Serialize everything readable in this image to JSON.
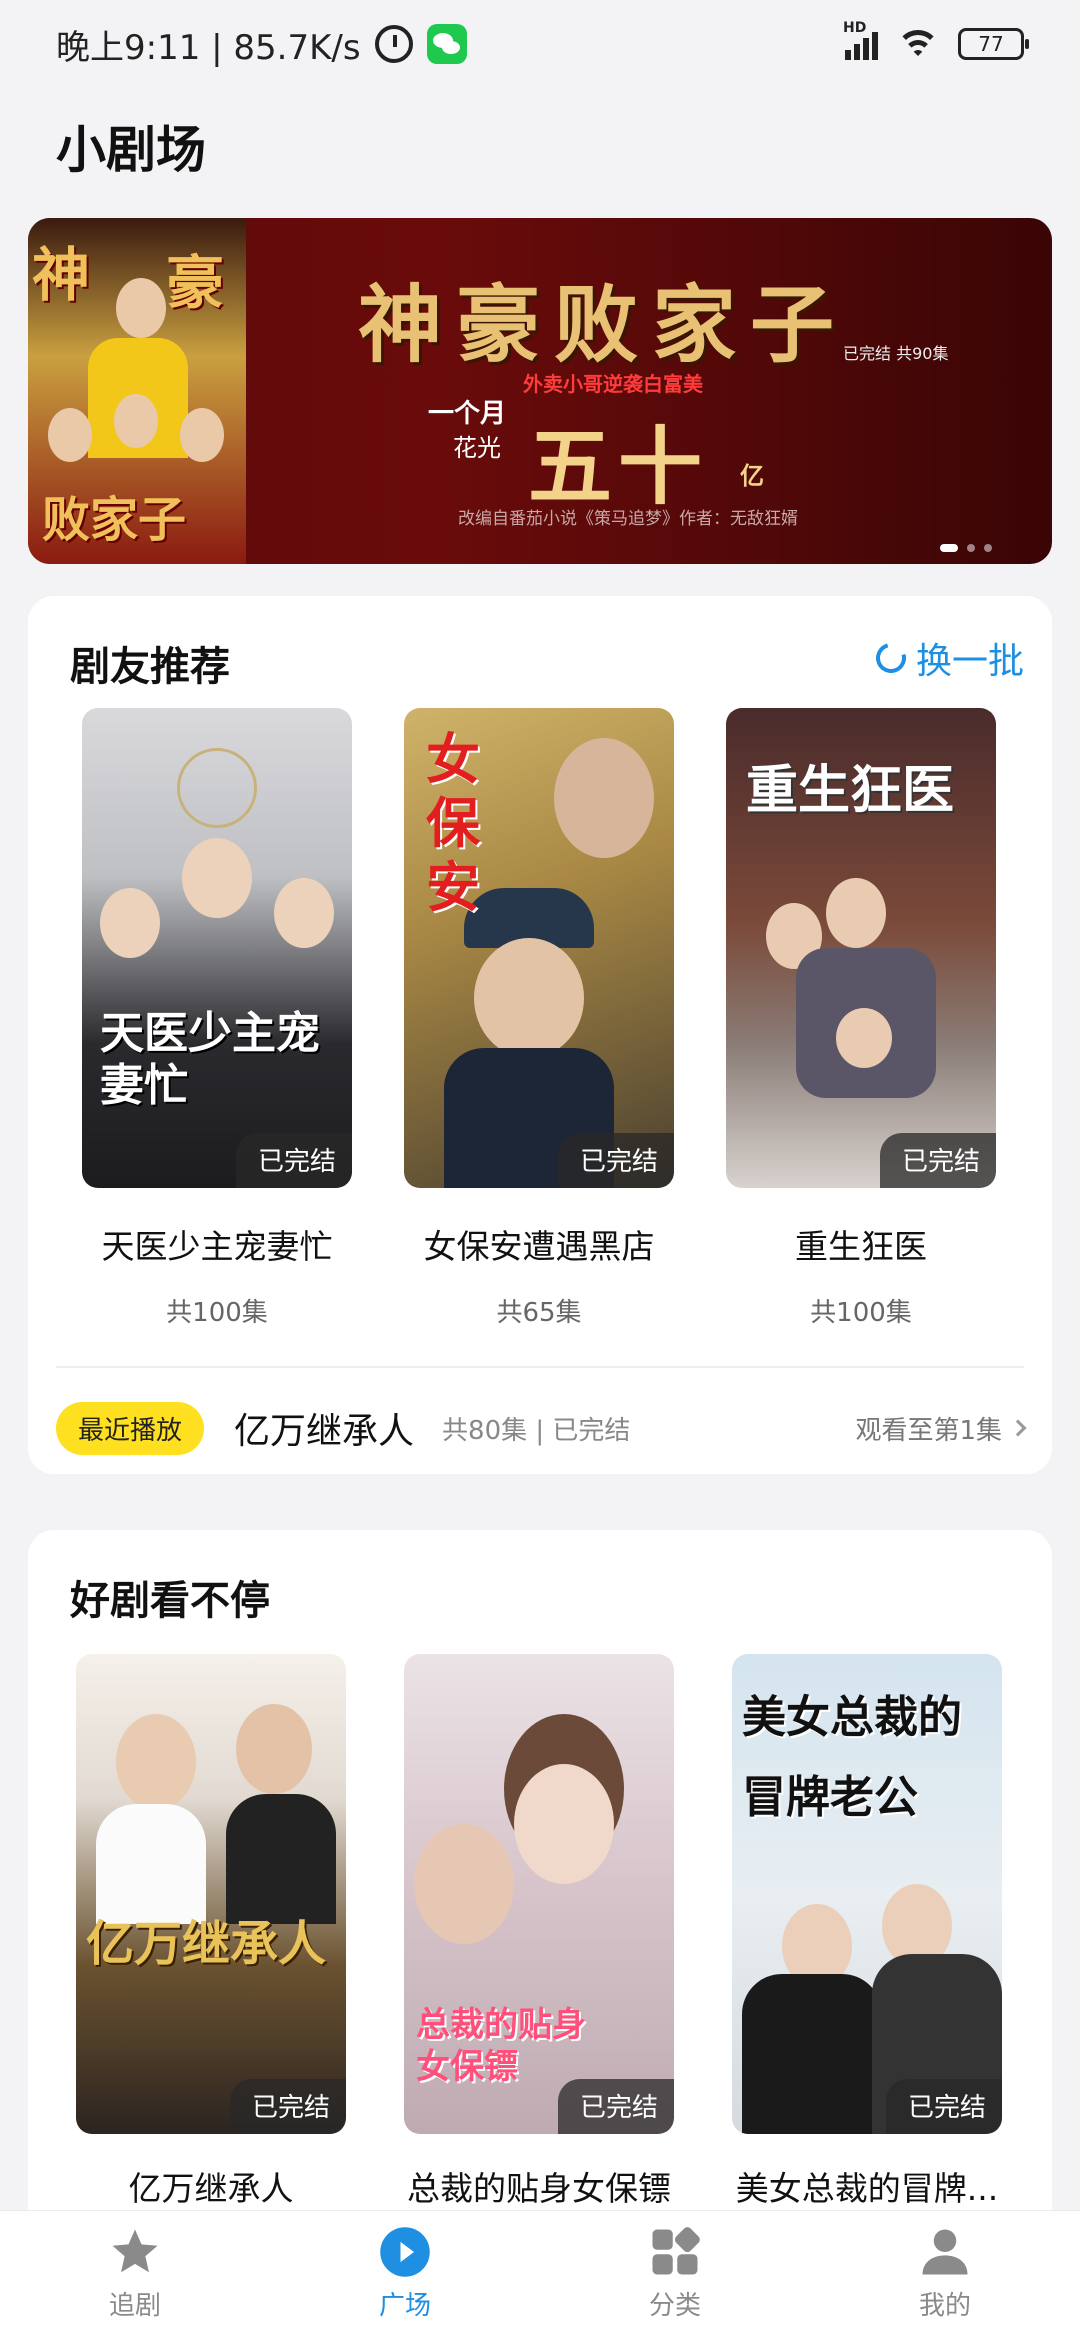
{
  "status_bar": {
    "time_text": "晚上9:11 | 85.7K/s",
    "hd_label": "HD",
    "battery": "77"
  },
  "page_title": "小剧场",
  "banner": {
    "title": "神豪败家子",
    "status": "已完结 共90集",
    "subtitle": "外卖小哥逆袭白富美",
    "line1": "一个月",
    "line2": "花光",
    "big_number": "五十",
    "unit": "亿",
    "credit": "改编自番茄小说《策马追梦》作者：无敌狂婿",
    "poster_chars": [
      "神",
      "豪",
      "败家子"
    ],
    "page_count": 3,
    "active_page": 1
  },
  "recommend": {
    "heading": "剧友推荐",
    "refresh_label": "换一批",
    "items": [
      {
        "title": "天医少主宠妻忙",
        "count": "共100集",
        "badge": "已完结",
        "poster_text": "天医少主宠妻忙"
      },
      {
        "title": "女保安遭遇黑店",
        "count": "共65集",
        "badge": "已完结",
        "poster_text": "女保安"
      },
      {
        "title": "重生狂医",
        "count": "共100集",
        "badge": "已完结",
        "poster_text": "重生狂医"
      }
    ],
    "recent": {
      "badge": "最近播放",
      "title": "亿万继承人",
      "meta": "共80集 | 已完结",
      "progress": "观看至第1集"
    }
  },
  "more": {
    "heading": "好剧看不停",
    "items": [
      {
        "title": "亿万继承人",
        "badge": "已完结",
        "poster_text": "亿万继承人"
      },
      {
        "title": "总裁的贴身女保镖",
        "badge": "已完结",
        "poster_text": "总裁的贴身女保镖"
      },
      {
        "title": "美女总裁的冒牌...",
        "badge": "已完结",
        "poster_text": "美女总裁的冒牌老公"
      }
    ]
  },
  "tabbar": {
    "items": [
      {
        "label": "追剧",
        "icon": "star-icon"
      },
      {
        "label": "广场",
        "icon": "play-icon"
      },
      {
        "label": "分类",
        "icon": "category-grid-icon"
      },
      {
        "label": "我的",
        "icon": "user-icon"
      }
    ],
    "active": 1
  },
  "colors": {
    "accent": "#1e8fe1",
    "recent_badge": "#ffe020"
  }
}
